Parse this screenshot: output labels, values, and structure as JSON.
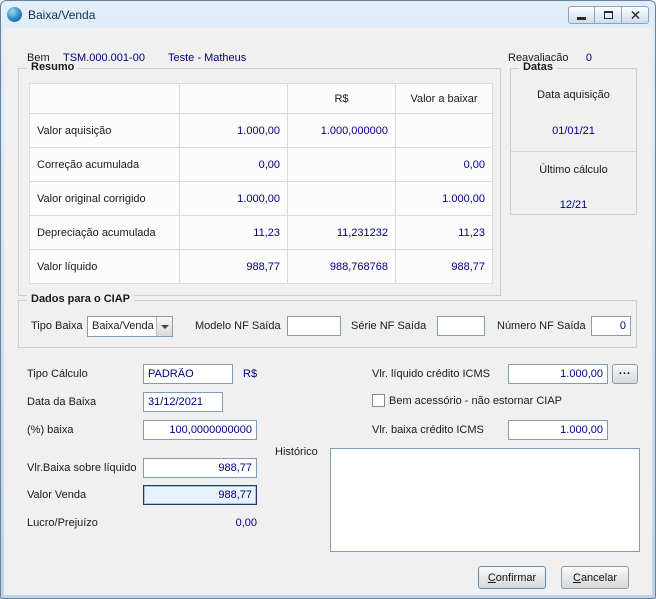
{
  "window": {
    "title": "Baixa/Venda"
  },
  "colors": {
    "value_text": "#000080",
    "frame": "#bdd4e9",
    "client_bg": "#f0f0f0"
  },
  "header": {
    "bem_label": "Bem",
    "bem_code": "TSM.000.001-00",
    "bem_name": "Teste - Matheus",
    "reavaliacao_label": "Reavaliação",
    "reavaliacao_value": "0"
  },
  "resumo": {
    "title": "Resumo",
    "columns": [
      "",
      "",
      "R$",
      "Valor a baixar"
    ],
    "rows": [
      {
        "label": "Valor aquisição",
        "valor": "1.000,00",
        "rs": "1.000,000000",
        "baixar": ""
      },
      {
        "label": "Correção acumulada",
        "valor": "0,00",
        "rs": "",
        "baixar": "0,00"
      },
      {
        "label": "Valor original corrigido",
        "valor": "1.000,00",
        "rs": "",
        "baixar": "1.000,00"
      },
      {
        "label": "Depreciação acumulada",
        "valor": "11,23",
        "rs": "11,231232",
        "baixar": "11,23"
      },
      {
        "label": "Valor líquido",
        "valor": "988,77",
        "rs": "988,768768",
        "baixar": "988,77"
      }
    ]
  },
  "datas": {
    "title": "Datas",
    "aquisicao_label": "Data aquisição",
    "aquisicao_value": "01/01/21",
    "ultimo_label": "Último cálculo",
    "ultimo_value": "12/21"
  },
  "ciap": {
    "title": "Dados para o CIAP",
    "tipo_baixa_label": "Tipo Baixa",
    "tipo_baixa_value": "Baixa/Venda",
    "modelo_label": "Modelo NF Saída",
    "modelo_value": "",
    "serie_label": "Série NF Saída",
    "serie_value": "",
    "numero_label": "Número NF Saída",
    "numero_value": "0"
  },
  "form": {
    "tipo_calculo_label": "Tipo Cálculo",
    "tipo_calculo_value": "PADRÃO",
    "currency_label": "R$",
    "data_baixa_label": "Data da Baixa",
    "data_baixa_value": "31/12/2021",
    "pct_baixa_label": "(%) baixa",
    "pct_baixa_value": "100,0000000000",
    "vlr_baixa_liquido_label": "Vlr.Baixa sobre líquido",
    "vlr_baixa_liquido_value": "988,77",
    "valor_venda_label": "Valor Venda",
    "valor_venda_value": "988,77",
    "lucro_label": "Lucro/Prejuízo",
    "lucro_value": "0,00",
    "vlr_liquido_icms_label": "Vlr. líquido crédito ICMS",
    "vlr_liquido_icms_value": "1.000,00",
    "browse_label": "...",
    "bem_acessorio_label": "Bem acessório - não estornar CIAP",
    "vlr_baixa_icms_label": "Vlr. baixa crédito ICMS",
    "vlr_baixa_icms_value": "1.000,00",
    "historico_label": "Histórico",
    "historico_value": ""
  },
  "footer": {
    "confirm_label": "Confirmar",
    "cancel_label": "Cancelar"
  }
}
